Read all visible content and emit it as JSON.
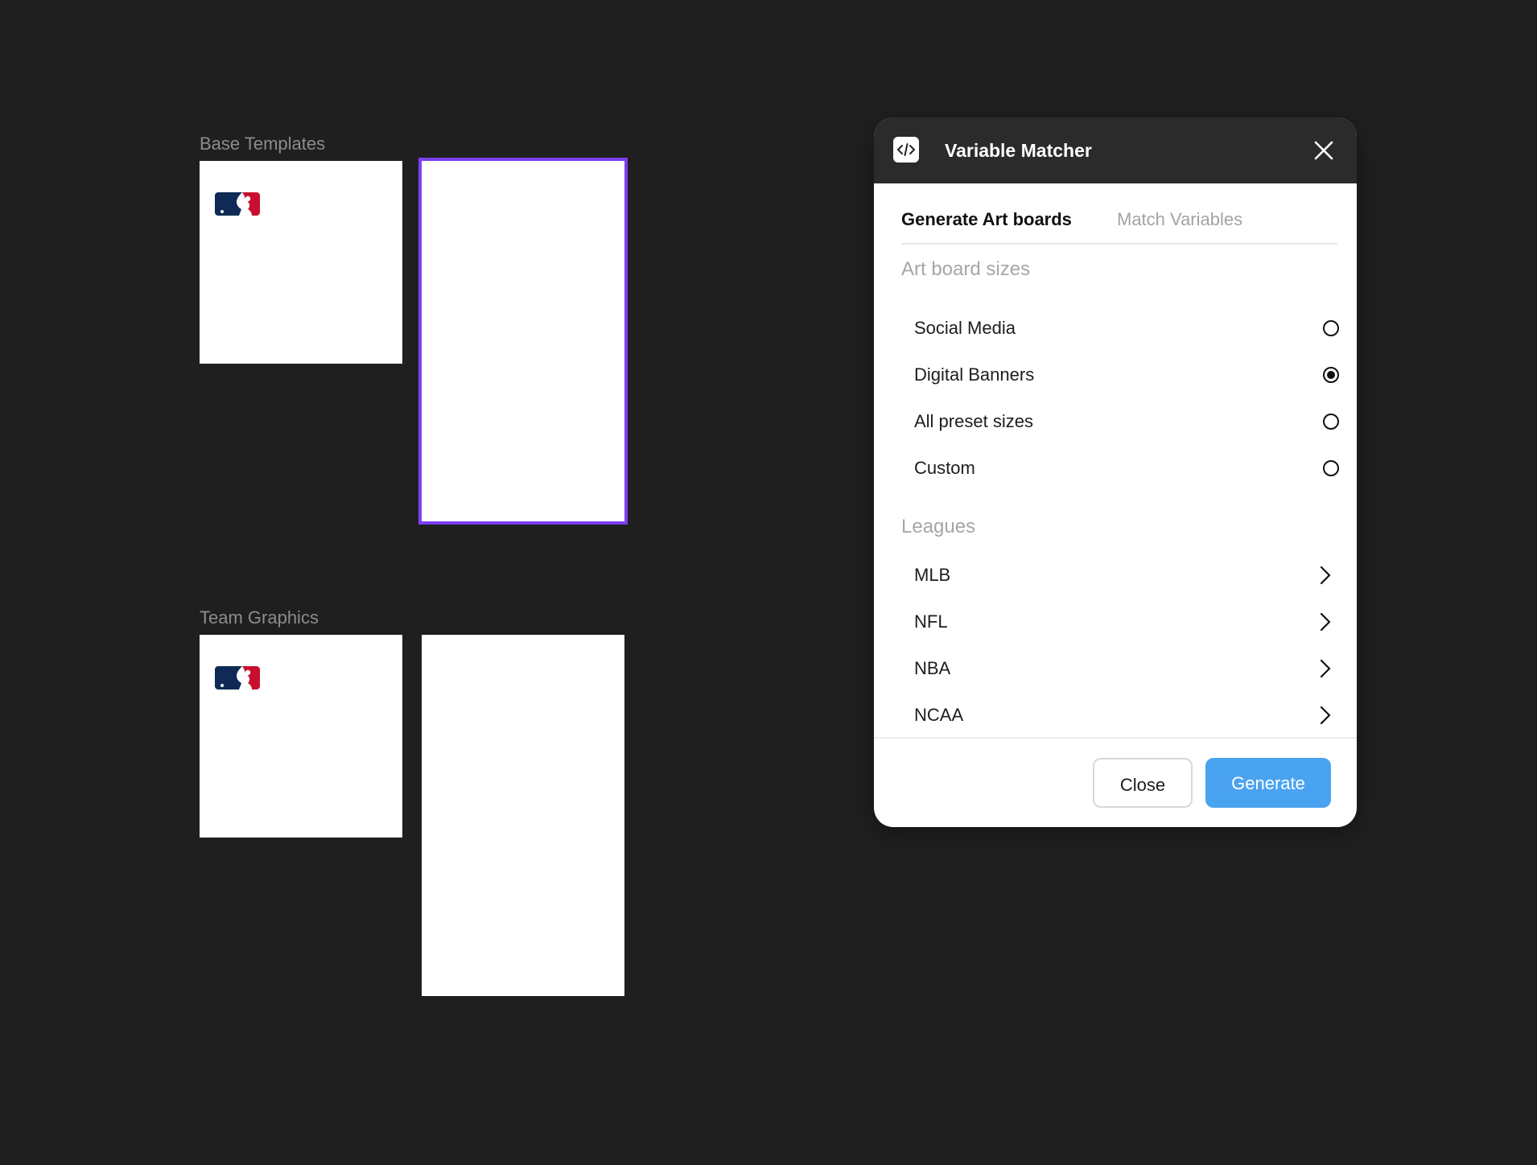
{
  "canvas": {
    "sections": [
      {
        "label": "Base Templates"
      },
      {
        "label": "Team Graphics"
      }
    ],
    "accent_selection_color": "#7b3ff2",
    "logo_icon": "mlb-logo-icon",
    "logo_colors": {
      "blue": "#0e2a55",
      "red": "#c8102e"
    }
  },
  "panel": {
    "title": "Variable Matcher",
    "plugin_icon": "code-icon",
    "close_icon": "close-icon",
    "tabs": [
      {
        "label": "Generate Art boards",
        "active": true
      },
      {
        "label": "Match Variables",
        "active": false
      }
    ],
    "sizes_heading": "Art board sizes",
    "sizes": [
      {
        "label": "Social Media",
        "selected": false
      },
      {
        "label": "Digital Banners",
        "selected": true
      },
      {
        "label": "All preset sizes",
        "selected": false
      },
      {
        "label": "Custom",
        "selected": false
      }
    ],
    "leagues_heading": "Leagues",
    "leagues": [
      {
        "label": "MLB"
      },
      {
        "label": "NFL"
      },
      {
        "label": "NBA"
      },
      {
        "label": "NCAA"
      }
    ],
    "buttons": {
      "close_label": "Close",
      "generate_label": "Generate"
    },
    "colors": {
      "header": "#2b2b2b",
      "primary_button": "#4aa3f0"
    }
  }
}
